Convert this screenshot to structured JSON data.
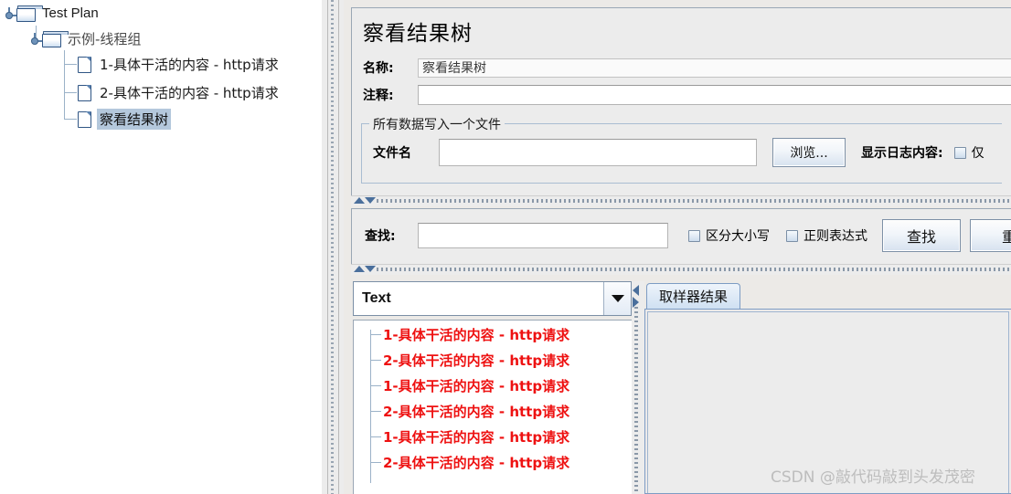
{
  "tree": {
    "nodes": [
      {
        "label": "Test Plan",
        "icon": "folder-icon",
        "selected": false,
        "depth": 0
      },
      {
        "label": "示例-线程组",
        "icon": "folder-icon",
        "selected": false,
        "depth": 1
      },
      {
        "label": "1-具体干活的内容 - http请求",
        "icon": "document-icon",
        "selected": false,
        "depth": 2
      },
      {
        "label": "2-具体干活的内容 - http请求",
        "icon": "document-icon",
        "selected": false,
        "depth": 2
      },
      {
        "label": "察看结果树",
        "icon": "document-icon",
        "selected": true,
        "depth": 2
      }
    ]
  },
  "panel": {
    "title": "察看结果树",
    "name_label": "名称:",
    "name_value": "察看结果树",
    "comment_label": "注释:",
    "comment_value": ""
  },
  "file_group": {
    "legend": "所有数据写入一个文件",
    "filename_label": "文件名",
    "filename_value": "",
    "browse_button": "浏览...",
    "log_display_label": "显示日志内容:",
    "log_checkbox_label": "仅",
    "log_checkbox_checked": false
  },
  "search": {
    "find_label": "查找:",
    "find_value": "",
    "case_sensitive_label": "区分大小写",
    "case_sensitive_checked": false,
    "regex_label": "正则表达式",
    "regex_checked": false,
    "find_button": "查找",
    "reset_button": "重"
  },
  "results": {
    "render_selector_value": "Text",
    "items": [
      "1-具体干活的内容 - http请求",
      "2-具体干活的内容 - http请求",
      "1-具体干活的内容 - http请求",
      "2-具体干活的内容 - http请求",
      "1-具体干活的内容 - http请求",
      "2-具体干活的内容 - http请求"
    ]
  },
  "detail": {
    "tabs": [
      {
        "label": "取样器结果",
        "active": true
      }
    ]
  },
  "watermark": {
    "text": "CSDN @敲代码敲到头发茂密"
  },
  "colors": {
    "result_red": "#ee1111",
    "selection_blue": "#b4c8dc",
    "panel_gray": "#ececec",
    "tab_blue": "#cfe0f2"
  }
}
